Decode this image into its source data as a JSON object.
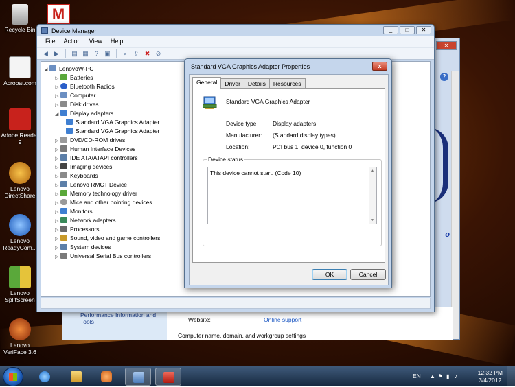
{
  "desktop_icons": [
    {
      "label": "Recycle Bin",
      "color": "#d8d8d8"
    },
    {
      "label": "Acrobat.com",
      "color": "#e8e8e8"
    },
    {
      "label": "Adobe Reader 9",
      "color": "#c8221c"
    },
    {
      "label": "Lenovo DirectShare",
      "color": "#e39a1e"
    },
    {
      "label": "Lenovo ReadyCom...",
      "color": "#2a74d6"
    },
    {
      "label": "Lenovo SplitScreen",
      "color": "#5aa83a"
    },
    {
      "label": "Lenovo VeriFace 3.6",
      "color": "#d4551a"
    }
  ],
  "background_window": {
    "left_link": "Performance Information and Tools",
    "website_label": "Website:",
    "website_link": "Online support",
    "section_text": "Computer name, domain, and workgroup settings",
    "help_glyph": "?",
    "brand_mark": "o"
  },
  "device_manager": {
    "title": "Device Manager",
    "menu": [
      "File",
      "Action",
      "View",
      "Help"
    ],
    "tree": {
      "root": "LenovoW-PC",
      "categories": [
        "Batteries",
        "Bluetooth Radios",
        "Computer",
        "Disk drives",
        "Display adapters",
        "DVD/CD-ROM drives",
        "Human Interface Devices",
        "IDE ATA/ATAPI controllers",
        "Imaging devices",
        "Keyboards",
        "Lenovo RMCT Device",
        "Memory technology driver",
        "Mice and other pointing devices",
        "Monitors",
        "Network adapters",
        "Processors",
        "Sound, video and game controllers",
        "System devices",
        "Universal Serial Bus controllers"
      ],
      "display_adapter_children": [
        "Standard VGA Graphics Adapter",
        "Standard VGA Graphics Adapter"
      ]
    }
  },
  "properties_dialog": {
    "title": "Standard VGA Graphics Adapter Properties",
    "close_glyph": "x",
    "tabs": [
      "General",
      "Driver",
      "Details",
      "Resources"
    ],
    "active_tab": "General",
    "device_name": "Standard VGA Graphics Adapter",
    "fields": [
      {
        "label": "Device type:",
        "value": "Display adapters"
      },
      {
        "label": "Manufacturer:",
        "value": "(Standard display types)"
      },
      {
        "label": "Location:",
        "value": "PCI bus 1, device 0, function 0"
      }
    ],
    "status_group_label": "Device status",
    "status_text": "This device cannot start. (Code 10)",
    "ok_label": "OK",
    "cancel_label": "Cancel"
  },
  "taskbar": {
    "language": "EN",
    "time": "12:32 PM",
    "date": "3/4/2012"
  },
  "colors": {
    "accent_blue": "#1a56c2",
    "window_frame": "#c5d6ec",
    "close_red": "#c33a22"
  }
}
